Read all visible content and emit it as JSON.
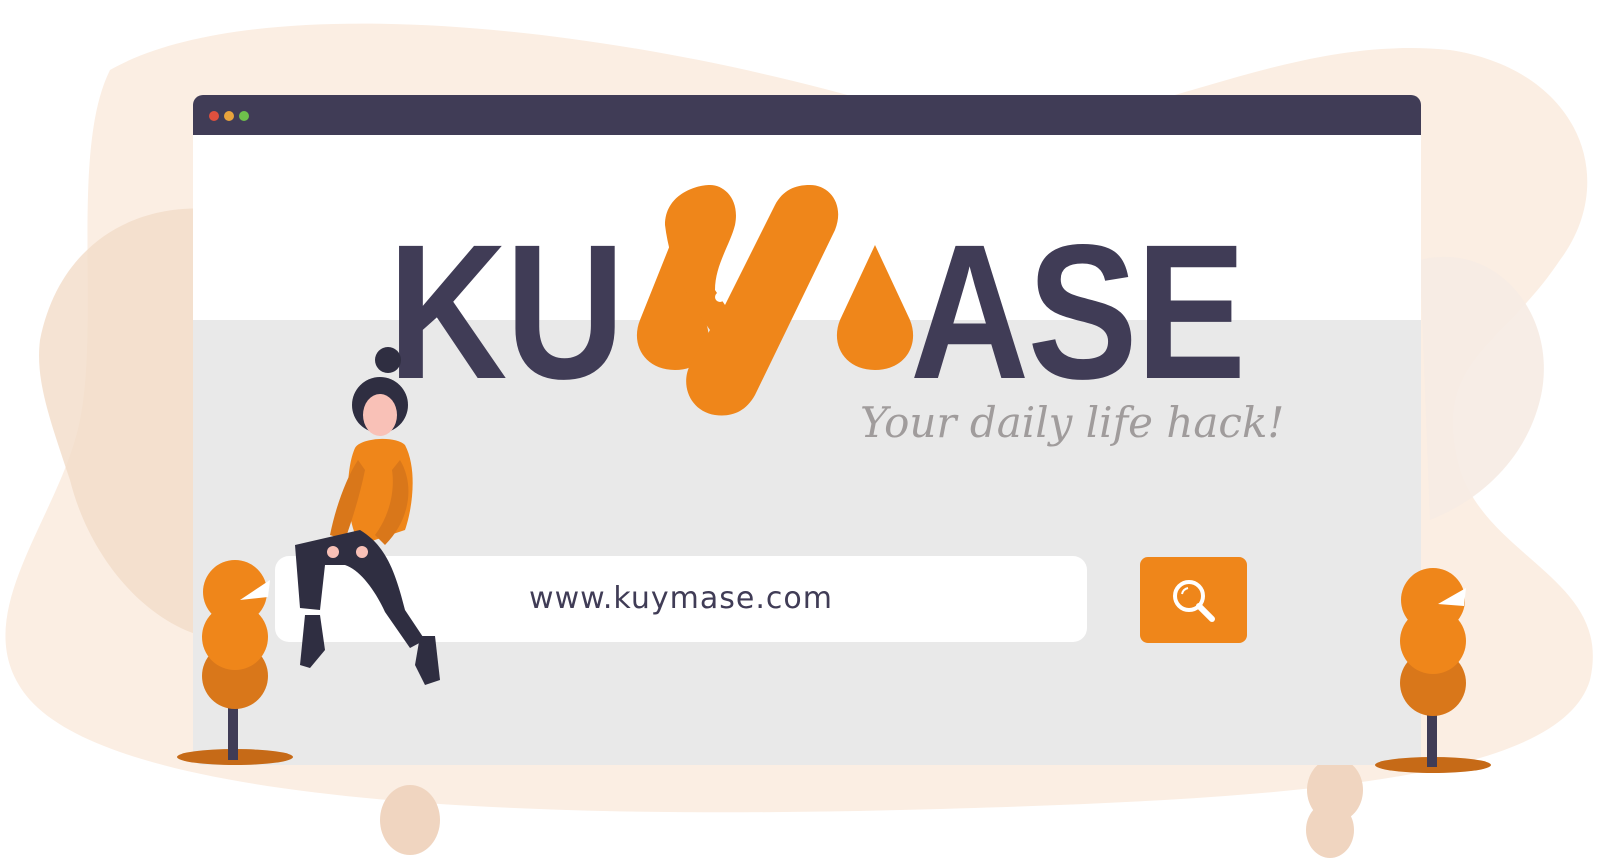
{
  "window": {
    "controls": [
      "close-dot",
      "minimize-dot",
      "maximize-dot"
    ]
  },
  "logo": {
    "text_left": "KU",
    "text_right": "ASE",
    "tagline": "Your daily life hack!"
  },
  "search": {
    "url": "www.kuymase.com",
    "button_icon": "search-icon"
  },
  "colors": {
    "accent": "#ef861a",
    "dark": "#403c56",
    "panel": "#e9e9e9",
    "tagline": "#a09c9c",
    "blob": "#fbeee3"
  }
}
